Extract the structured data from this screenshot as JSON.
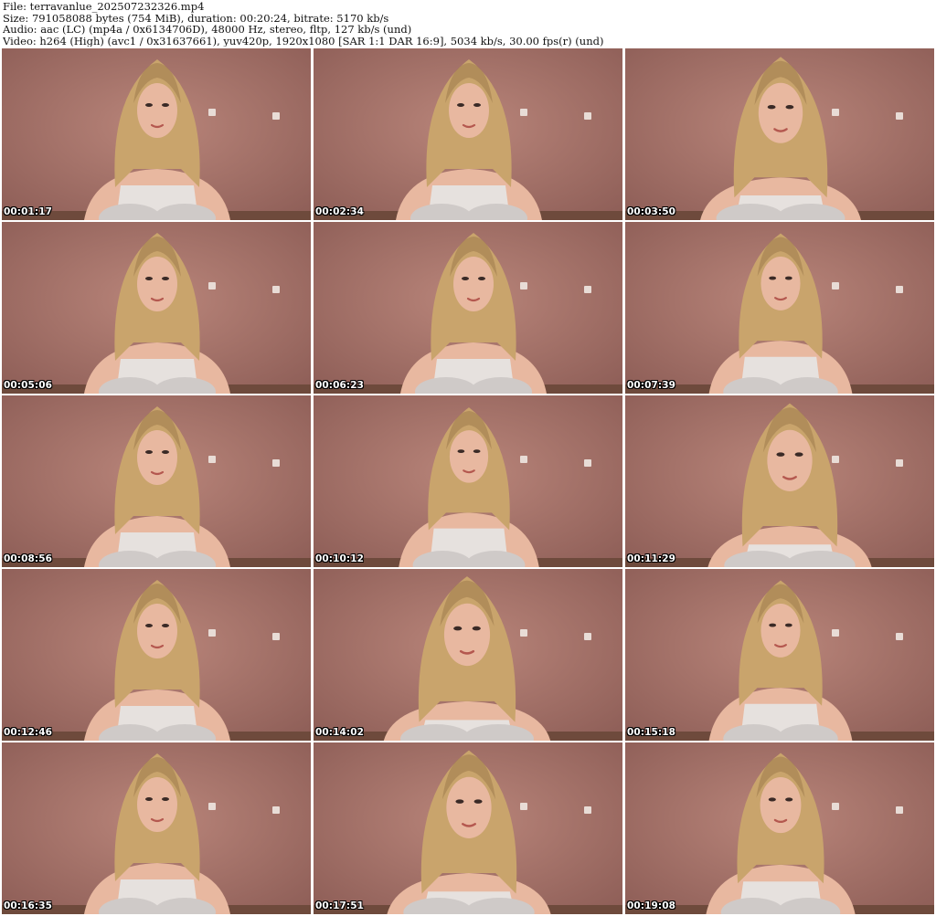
{
  "header": {
    "file": "File: terravanlue_202507232326.mp4",
    "size": "Size: 791058088 bytes (754 MiB), duration: 00:20:24, bitrate: 5170 kb/s",
    "audio": "Audio: aac (LC) (mp4a / 0x6134706D), 48000 Hz, stereo, fltp, 127 kb/s (und)",
    "video": "Video: h264 (High) (avc1 / 0x31637661), yuv420p, 1920x1080 [SAR 1:1 DAR 16:9], 5034 kb/s, 30.00 fps(r) (und)"
  },
  "colors": {
    "wall": "#b9857a",
    "wall_dark": "#8f5f58",
    "hair": "#c9a46c",
    "hair_dark": "#9c7a4c",
    "skin": "#e8b8a0",
    "top": "#e6e1de",
    "knees": "#cfcac8",
    "floor": "#6e4a3c"
  },
  "thumbnails": [
    {
      "time": "00:01:17",
      "icon": "video-frame-thumbnail"
    },
    {
      "time": "00:02:34",
      "icon": "video-frame-thumbnail"
    },
    {
      "time": "00:03:50",
      "icon": "video-frame-thumbnail"
    },
    {
      "time": "00:05:06",
      "icon": "video-frame-thumbnail"
    },
    {
      "time": "00:06:23",
      "icon": "video-frame-thumbnail"
    },
    {
      "time": "00:07:39",
      "icon": "video-frame-thumbnail"
    },
    {
      "time": "00:08:56",
      "icon": "video-frame-thumbnail"
    },
    {
      "time": "00:10:12",
      "icon": "video-frame-thumbnail"
    },
    {
      "time": "00:11:29",
      "icon": "video-frame-thumbnail"
    },
    {
      "time": "00:12:46",
      "icon": "video-frame-thumbnail"
    },
    {
      "time": "00:14:02",
      "icon": "video-frame-thumbnail"
    },
    {
      "time": "00:15:18",
      "icon": "video-frame-thumbnail"
    },
    {
      "time": "00:16:35",
      "icon": "video-frame-thumbnail"
    },
    {
      "time": "00:17:51",
      "icon": "video-frame-thumbnail"
    },
    {
      "time": "00:19:08",
      "icon": "video-frame-thumbnail"
    }
  ]
}
